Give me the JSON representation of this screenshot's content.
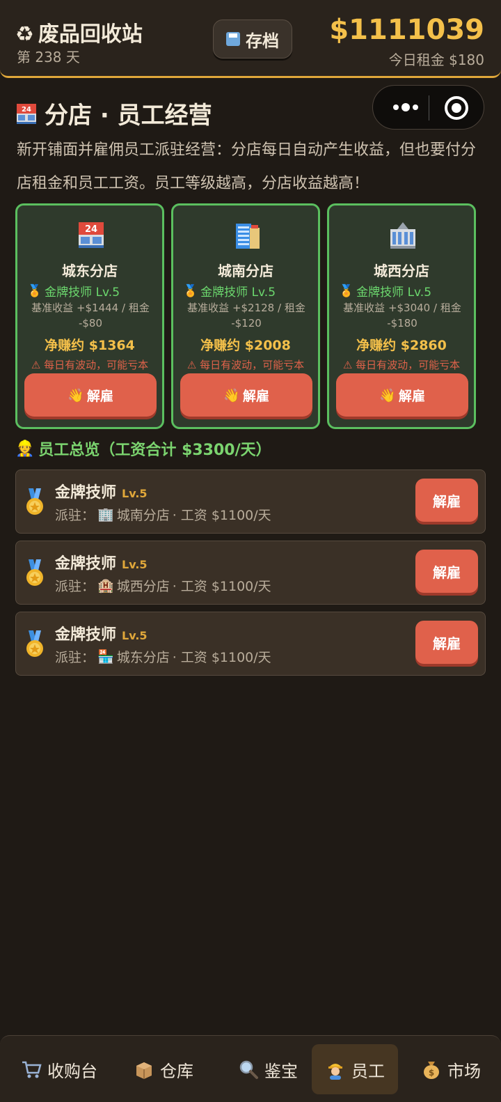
{
  "header": {
    "app_title": "废品回收站",
    "day": "第 238 天",
    "save_label": "存档",
    "money": "$1111039",
    "rent": "今日租金 $180"
  },
  "page": {
    "title": "分店 · 员工经营",
    "description": "新开铺面并雇佣员工派驻经营：分店每日自动产生收益，但也要付分店租金和员工工资。员工等级越高，分店收益越高！"
  },
  "branches": [
    {
      "name": "城东分店",
      "staff": "金牌技师 Lv.5",
      "base": "基准收益 +$1444 / 租金 -$80",
      "net": "净赚约 $1364",
      "warn": "⚠ 每日有波动，可能亏本",
      "fire": "解雇",
      "icon": "convenience-store-icon"
    },
    {
      "name": "城南分店",
      "staff": "金牌技师 Lv.5",
      "base": "基准收益 +$2128 / 租金 -$120",
      "net": "净赚约 $2008",
      "warn": "⚠ 每日有波动，可能亏本",
      "fire": "解雇",
      "icon": "office-building-icon"
    },
    {
      "name": "城西分店",
      "staff": "金牌技师 Lv.5",
      "base": "基准收益 +$3040 / 租金 -$180",
      "net": "净赚约 $2860",
      "warn": "⚠ 每日有波动，可能亏本",
      "fire": "解雇",
      "icon": "hotel-icon"
    }
  ],
  "overview": {
    "title": "员工总览（工资合计 $3300/天）"
  },
  "employees": [
    {
      "name": "金牌技师",
      "level": "Lv.5",
      "assign_prefix": "派驻：",
      "branch": "城南分店",
      "wage": "· 工资 $1100/天",
      "fire": "解雇"
    },
    {
      "name": "金牌技师",
      "level": "Lv.5",
      "assign_prefix": "派驻：",
      "branch": "城西分店",
      "wage": "· 工资 $1100/天",
      "fire": "解雇"
    },
    {
      "name": "金牌技师",
      "level": "Lv.5",
      "assign_prefix": "派驻：",
      "branch": "城东分店",
      "wage": "· 工资 $1100/天",
      "fire": "解雇"
    }
  ],
  "nav": [
    {
      "label": "收购台",
      "icon": "cart-icon"
    },
    {
      "label": "仓库",
      "icon": "box-icon"
    },
    {
      "label": "鉴宝",
      "icon": "magnifier-icon"
    },
    {
      "label": "员工",
      "icon": "worker-icon",
      "active": true
    },
    {
      "label": "市场",
      "icon": "money-bag-icon"
    }
  ],
  "colors": {
    "accent": "#e0a73a",
    "money": "#f4c04a",
    "green": "#5bbf5f",
    "danger": "#e0614b"
  }
}
